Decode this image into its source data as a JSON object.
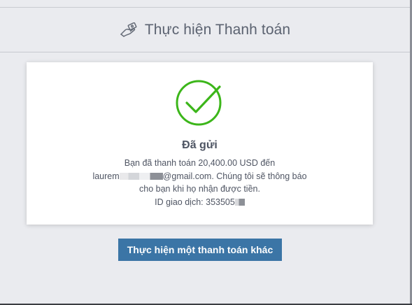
{
  "header": {
    "icon": "hand-money-icon",
    "title": "Thực hiện Thanh toán"
  },
  "result": {
    "icon": "check-circle-icon",
    "status_title": "Đã gửi",
    "line1": "Bạn đã thanh toán 20,400.00 USD đến",
    "email_prefix": "laurem",
    "email_suffix": "@gmail.com. Chúng tôi sẽ thông báo",
    "line3": "cho bạn khi họ nhận được tiền.",
    "transaction_prefix": "ID giao dịch: 353505"
  },
  "actions": {
    "new_payment_label": "Thực hiện một thanh toán khác"
  },
  "colors": {
    "success": "#3cb61a",
    "primary_button": "#3b75a6"
  }
}
